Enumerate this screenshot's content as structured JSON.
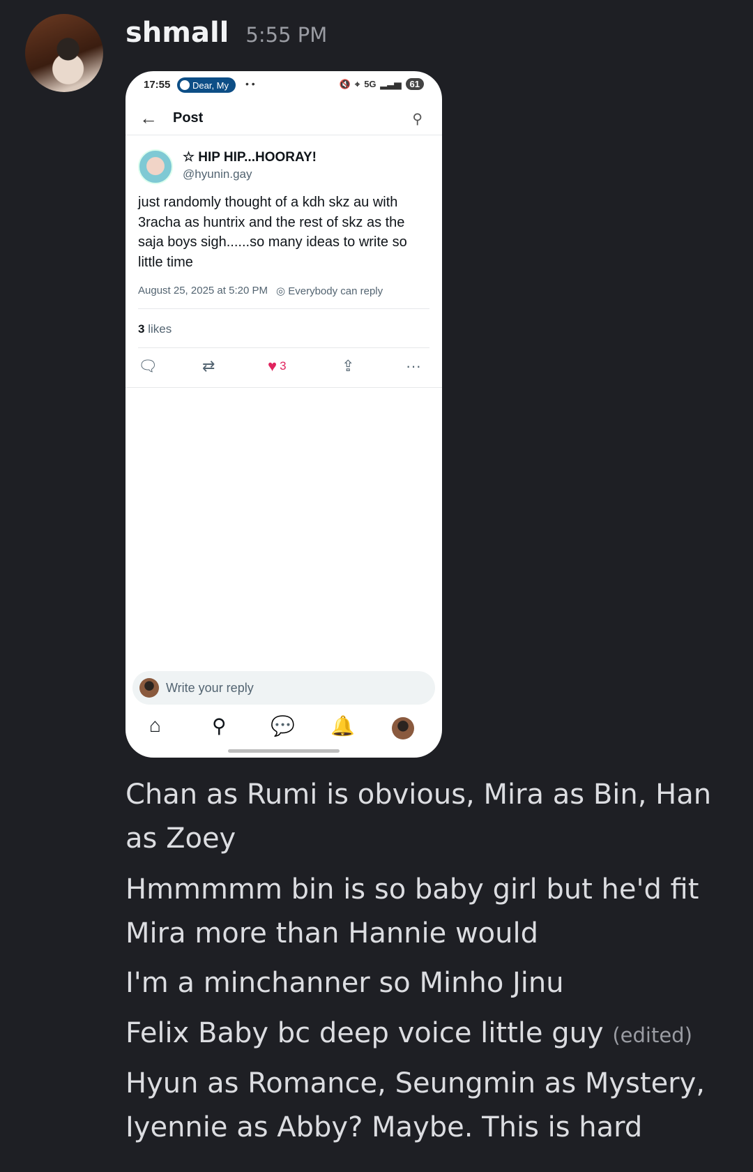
{
  "message": {
    "username": "shmall",
    "timestamp": "5:55 PM",
    "avatar_icon": "user-avatar"
  },
  "screenshot": {
    "status_bar": {
      "time": "17:55",
      "spotify_label": "Dear, My",
      "misc": "• •",
      "network": "5G",
      "battery": "61"
    },
    "nav": {
      "title": "Post"
    },
    "post": {
      "author_name": "☆ HIP HIP...HOORAY!",
      "author_handle": "@hyunin.gay",
      "text": "just randomly thought of a kdh skz au with 3racha as huntrix and the rest of skz as the saja boys sigh......so many ideas to write so little time",
      "date": "August 25, 2025 at 5:20 PM",
      "reply_setting": "Everybody can reply",
      "likes_count": "3",
      "likes_label": "likes",
      "heart_count": "3"
    },
    "reply_placeholder": "Write your reply"
  },
  "messages": [
    {
      "text": "Chan as Rumi is obvious, Mira as Bin, Han as Zoey"
    },
    {
      "text": "Hmmmmm bin is so baby girl but he'd fit Mira more than Hannie would"
    },
    {
      "text": "I'm a minchanner so Minho Jinu"
    },
    {
      "text": "Felix Baby bc deep voice little guy",
      "edited": "(edited)"
    },
    {
      "text": "Hyun as Romance, Seungmin as Mystery, Iyennie as Abby? Maybe. This is hard"
    }
  ]
}
